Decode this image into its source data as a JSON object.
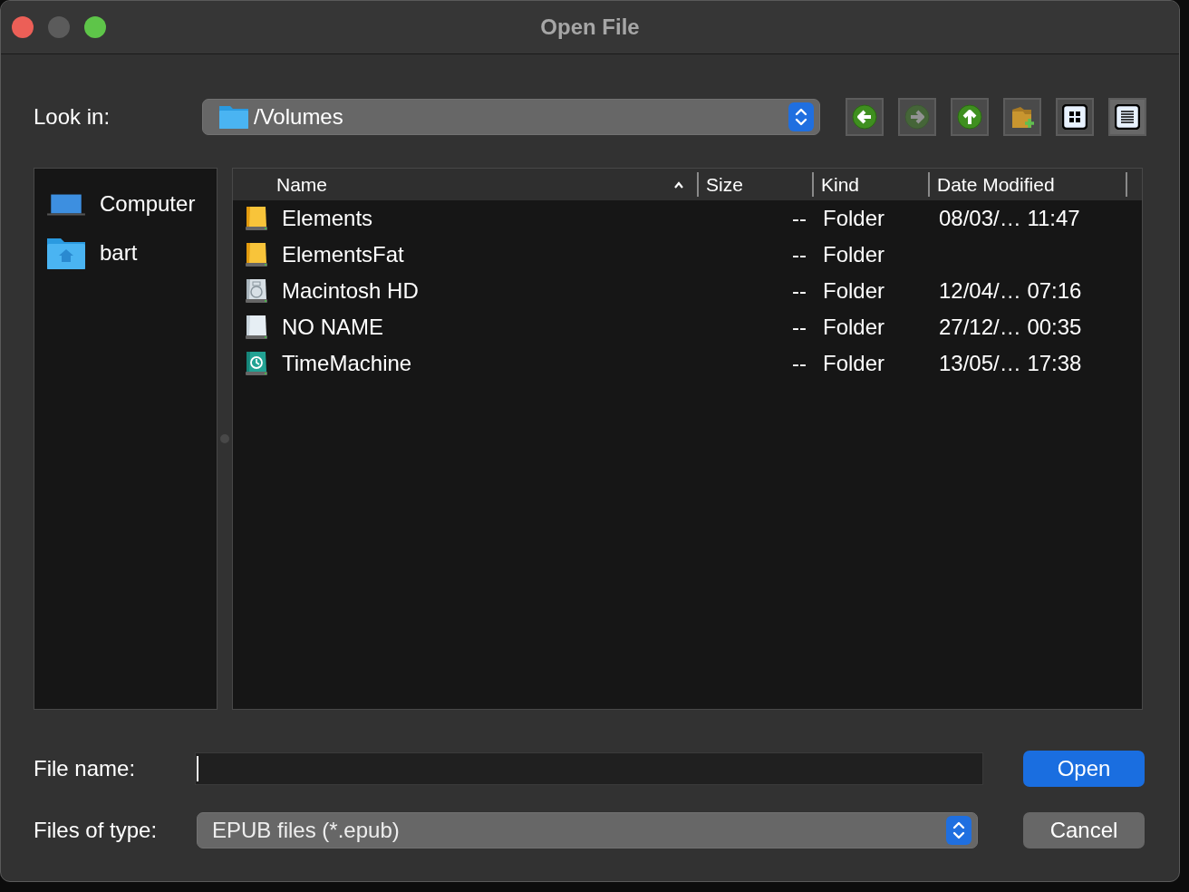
{
  "window": {
    "title": "Open File"
  },
  "look_in": {
    "label": "Look in:",
    "path": "/Volumes"
  },
  "toolbar": [
    {
      "kind": "back",
      "disabled": false
    },
    {
      "kind": "forward",
      "disabled": true
    },
    {
      "kind": "up",
      "disabled": false
    },
    {
      "kind": "new-folder",
      "disabled": false
    }
  ],
  "view_modes": [
    {
      "kind": "icons",
      "selected": false
    },
    {
      "kind": "list",
      "selected": true
    }
  ],
  "sidebar": {
    "items": [
      {
        "kind": "computer",
        "label": "Computer"
      },
      {
        "kind": "home",
        "label": "bart"
      }
    ]
  },
  "table": {
    "columns": [
      {
        "label": "Name",
        "sorted": true
      },
      {
        "label": "Size",
        "sorted": false
      },
      {
        "label": "Kind",
        "sorted": false
      },
      {
        "label": "Date Modified",
        "sorted": false
      }
    ],
    "rows": [
      {
        "icon": {
          "kind": "external"
        },
        "name": "Elements",
        "size": "--",
        "kind": "Folder",
        "date_modified": "08/03/… 11:47"
      },
      {
        "icon": {
          "kind": "external"
        },
        "name": "ElementsFat",
        "size": "--",
        "kind": "Folder"
      },
      {
        "icon": {
          "kind": "internal"
        },
        "name": "Macintosh HD",
        "size": "--",
        "kind": "Folder",
        "date_modified": "12/04/… 07:16"
      },
      {
        "icon": {
          "kind": "removable"
        },
        "name": "NO NAME",
        "size": "--",
        "kind": "Folder",
        "date_modified": "27/12/… 00:35"
      },
      {
        "icon": {
          "kind": "backup"
        },
        "name": "TimeMachine",
        "size": "--",
        "kind": "Folder",
        "date_modified": "13/05/… 17:38"
      }
    ]
  },
  "file_name": {
    "label": "File name:"
  },
  "files_of_type": {
    "label": "Files of type:",
    "value": "EPUB files (*.epub)"
  },
  "buttons": [
    {
      "label": "Open",
      "default": true
    },
    {
      "label": "Cancel",
      "default": false
    }
  ]
}
